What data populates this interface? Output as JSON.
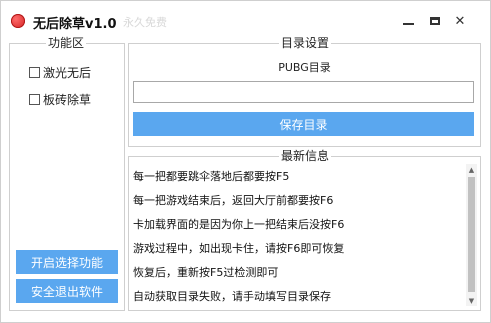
{
  "window": {
    "title": "无后除草v1.0",
    "ghost_text": "永久免费",
    "controls": {
      "minimize": "minimize",
      "maximize": "maximize",
      "close": "✕"
    }
  },
  "colors": {
    "button_bg": "#5aa7ef",
    "button_text": "#ffffff",
    "border": "#cfcfcf"
  },
  "features": {
    "legend": "功能区",
    "options": [
      {
        "label": "激光无后",
        "checked": false
      },
      {
        "label": "板砖除草",
        "checked": false
      }
    ],
    "start_button": "开启选择功能",
    "exit_button": "安全退出软件"
  },
  "directory": {
    "legend": "目录设置",
    "label": "PUBG目录",
    "input_value": "",
    "input_placeholder": "",
    "save_button": "保存目录"
  },
  "info": {
    "legend": "最新信息",
    "lines": [
      "每一把都要跳伞落地后都要按F5",
      "每一把游戏结束后，返回大厅前都要按F6",
      "卡加载界面的是因为你上一把结束后没按F6",
      "游戏过程中，如出现卡住，请按F6即可恢复",
      "恢复后，重新按F5过检测即可",
      "自动获取目录失败，请手动填写目录保存"
    ]
  }
}
